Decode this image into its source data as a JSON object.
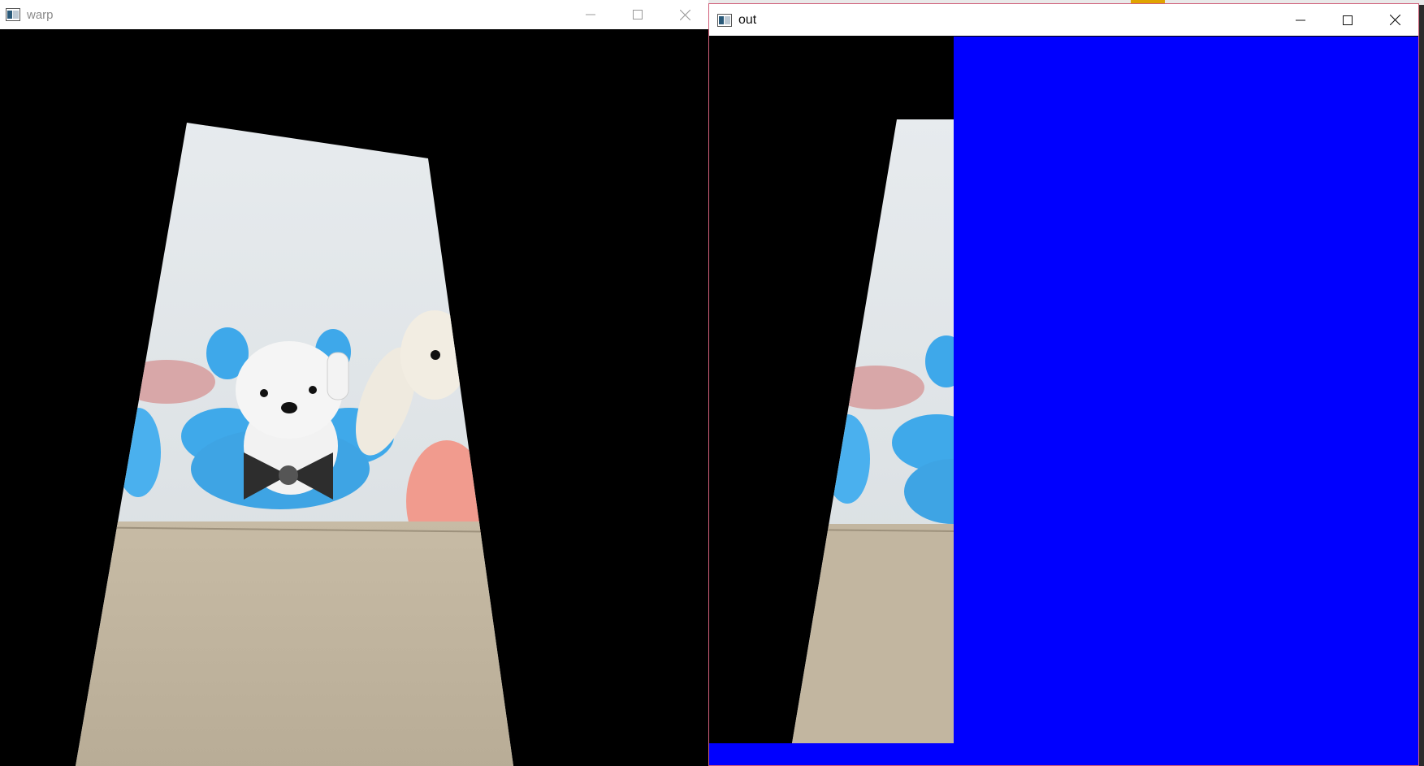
{
  "background": {
    "accent_color": "#e0a400"
  },
  "windows": [
    {
      "id": "warp",
      "title": "warp",
      "app_icon": "opencv-window-icon",
      "controls": [
        "minimize-icon",
        "maximize-icon",
        "close-icon"
      ],
      "active": false,
      "content_background": "#000000"
    },
    {
      "id": "out",
      "title": "out",
      "app_icon": "opencv-window-icon",
      "controls": [
        "minimize-icon",
        "maximize-icon",
        "close-icon"
      ],
      "active": true,
      "content_background": "#000000",
      "fill_color": "#0000ff"
    }
  ]
}
